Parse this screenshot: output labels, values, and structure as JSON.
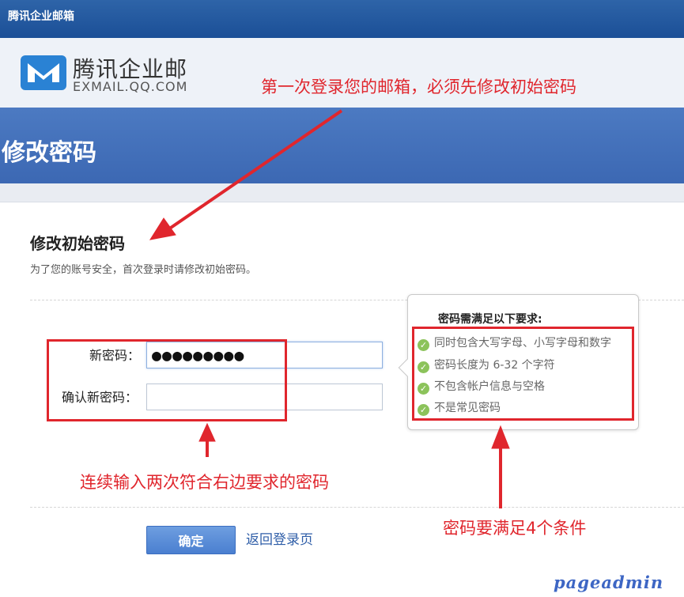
{
  "window": {
    "title": "腾讯企业邮箱"
  },
  "brand": {
    "name_cn": "腾讯企业邮",
    "name_en": "EXMAIL.QQ.COM",
    "color": "#2a82d4"
  },
  "banner": {
    "title": "修改密码"
  },
  "form": {
    "title": "修改初始密码",
    "description": "为了您的账号安全，首次登录时请修改初始密码。",
    "new_password": {
      "label": "新密码：",
      "value": "●●●●●●●●●"
    },
    "confirm_password": {
      "label": "确认新密码：",
      "value": ""
    },
    "submit_label": "确定",
    "back_link": "返回登录页"
  },
  "requirements": {
    "title": "密码需满足以下要求:",
    "items": [
      "同时包含大写字母、小写字母和数字",
      "密码长度为 6-32 个字符",
      "不包含帐户信息与空格",
      "不是常见密码"
    ]
  },
  "annotations": {
    "top": "第一次登录您的邮箱，必须先修改初始密码",
    "left": "连续输入两次符合右边要求的密码",
    "right": "密码要满足4个条件",
    "color": "#e0262d"
  },
  "watermark": "pageadmin"
}
